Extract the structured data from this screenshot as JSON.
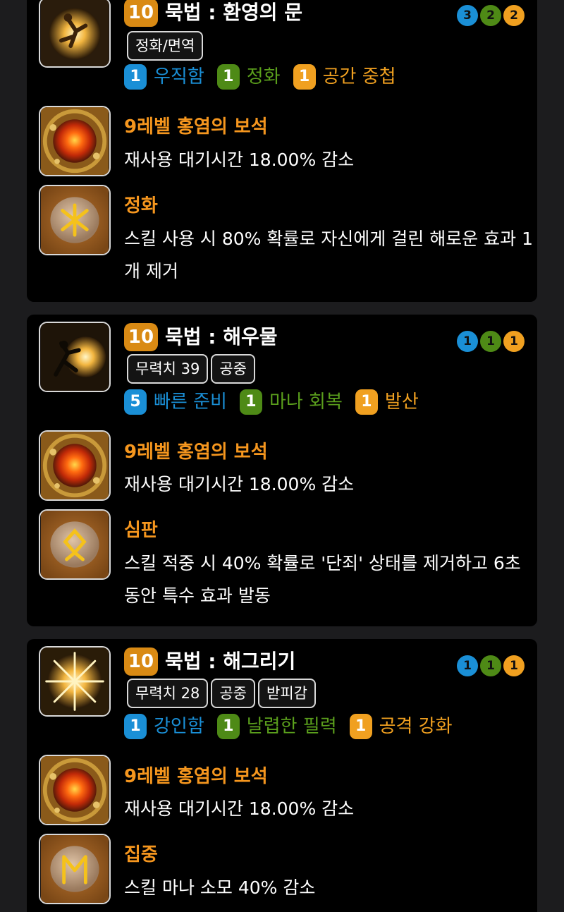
{
  "colors": {
    "blue": "#1a8fd6",
    "green": "#4e8a16",
    "orange": "#f0a020",
    "title_orange": "#f5961e",
    "card_bg": "#000000",
    "page_bg": "#1c1c1e"
  },
  "cards": [
    {
      "level": "10",
      "title": "묵법 : 환영의 문",
      "skill_icon": "phantom-gate-skill-icon",
      "tags": [
        "정화/면역"
      ],
      "dots": [
        "3",
        "2",
        "2"
      ],
      "tripods": [
        {
          "num": "1",
          "name": "우직함",
          "color": "blue"
        },
        {
          "num": "1",
          "name": "정화",
          "color": "green"
        },
        {
          "num": "1",
          "name": "공간 중첩",
          "color": "orange"
        }
      ],
      "gem": {
        "icon": "crimson-flame-gem-icon",
        "title": "9레벨 홍염의 보석",
        "desc": "재사용 대기시간 18.00% 감소"
      },
      "rune": {
        "icon": "purify-rune-icon",
        "title": "정화",
        "desc": "스킬 사용 시 80% 확률로 자신에게 걸린 해로운 효과 1개 제거"
      }
    },
    {
      "level": "10",
      "title": "묵법 : 해우물",
      "skill_icon": "sun-well-skill-icon",
      "tags": [
        "무력치 39",
        "공중"
      ],
      "dots": [
        "1",
        "1",
        "1"
      ],
      "tripods": [
        {
          "num": "5",
          "name": "빠른 준비",
          "color": "blue"
        },
        {
          "num": "1",
          "name": "마나 회복",
          "color": "green"
        },
        {
          "num": "1",
          "name": "발산",
          "color": "orange"
        }
      ],
      "gem": {
        "icon": "crimson-flame-gem-icon",
        "title": "9레벨 홍염의 보석",
        "desc": "재사용 대기시간 18.00% 감소"
      },
      "rune": {
        "icon": "judgment-rune-icon",
        "title": "심판",
        "desc": "스킬 적중 시 40% 확률로 '단죄' 상태를 제거하고 6초 동안 특수 효과 발동"
      }
    },
    {
      "level": "10",
      "title": "묵법 : 해그리기",
      "skill_icon": "sun-drawing-skill-icon",
      "tags": [
        "무력치 28",
        "공중",
        "받피감"
      ],
      "dots": [
        "1",
        "1",
        "1"
      ],
      "tripods": [
        {
          "num": "1",
          "name": "강인함",
          "color": "blue"
        },
        {
          "num": "1",
          "name": "날렵한 필력",
          "color": "green"
        },
        {
          "num": "1",
          "name": "공격 강화",
          "color": "orange"
        }
      ],
      "gem": {
        "icon": "crimson-flame-gem-icon",
        "title": "9레벨 홍염의 보석",
        "desc": "재사용 대기시간 18.00% 감소"
      },
      "rune": {
        "icon": "focus-rune-icon",
        "title": "집중",
        "desc": "스킬 마나 소모 40% 감소"
      }
    }
  ]
}
